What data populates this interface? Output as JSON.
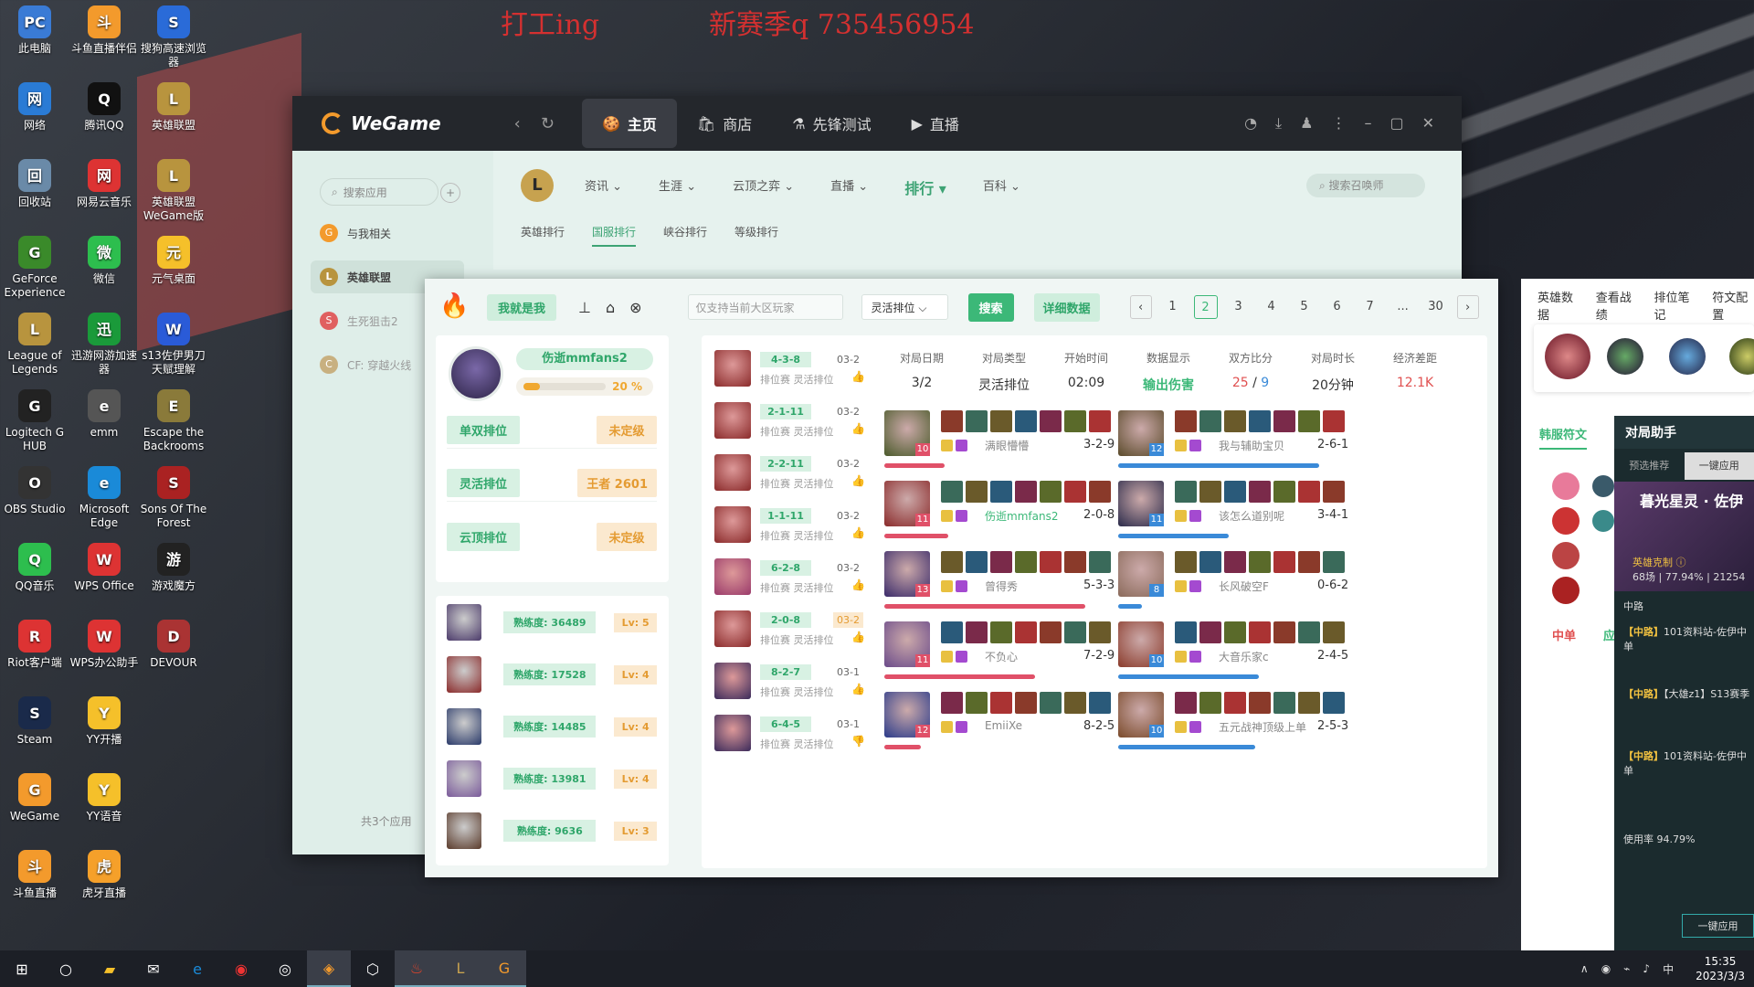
{
  "desktop_notes": [
    "打工ing",
    "新赛季q 735456954"
  ],
  "desktop_icons": [
    {
      "label": "此电脑",
      "color": "#3a7bd5",
      "g": "PC"
    },
    {
      "label": "斗鱼直播伴侣",
      "color": "#f39a2c",
      "g": "斗"
    },
    {
      "label": "搜狗高速浏览器",
      "color": "#2a6bd8",
      "g": "S"
    },
    {
      "label": "网络",
      "color": "#2a7bd5",
      "g": "网"
    },
    {
      "label": "腾讯QQ",
      "color": "#111",
      "g": "Q"
    },
    {
      "label": "英雄联盟",
      "color": "#b8943e",
      "g": "L"
    },
    {
      "label": "回收站",
      "color": "#6a8aa8",
      "g": "回"
    },
    {
      "label": "网易云音乐",
      "color": "#d33",
      "g": "网"
    },
    {
      "label": "英雄联盟WeGame版",
      "color": "#b8943e",
      "g": "L"
    },
    {
      "label": "GeForce Experience",
      "color": "#3a8a2a",
      "g": "G"
    },
    {
      "label": "微信",
      "color": "#2dbe4e",
      "g": "微"
    },
    {
      "label": "元气桌面",
      "color": "#f5c02a",
      "g": "元"
    },
    {
      "label": "League of Legends",
      "color": "#b8943e",
      "g": "L"
    },
    {
      "label": "迅游网游加速器",
      "color": "#1a9a3a",
      "g": "迅"
    },
    {
      "label": "s13佐伊男刀天赋理解",
      "color": "#2a5bd8",
      "g": "W"
    },
    {
      "label": "Logitech G HUB",
      "color": "#222",
      "g": "G"
    },
    {
      "label": "emm",
      "color": "#555",
      "g": "e"
    },
    {
      "label": "Escape the Backrooms",
      "color": "#8a7a3a",
      "g": "E"
    },
    {
      "label": "OBS Studio",
      "color": "#333",
      "g": "O"
    },
    {
      "label": "Microsoft Edge",
      "color": "#1a8ad8",
      "g": "e"
    },
    {
      "label": "Sons Of The Forest",
      "color": "#a22",
      "g": "S"
    },
    {
      "label": "QQ音乐",
      "color": "#2dbe4e",
      "g": "Q"
    },
    {
      "label": "WPS Office",
      "color": "#d33",
      "g": "W"
    },
    {
      "label": "游戏魔方",
      "color": "#222",
      "g": "游"
    },
    {
      "label": "Riot客户端",
      "color": "#d33",
      "g": "R"
    },
    {
      "label": "WPS办公助手",
      "color": "#d33",
      "g": "W"
    },
    {
      "label": "DEVOUR",
      "color": "#a33",
      "g": "D"
    },
    {
      "label": "Steam",
      "color": "#1a2a4a",
      "g": "S"
    },
    {
      "label": "YY开播",
      "color": "#f5c02a",
      "g": "Y"
    },
    {
      "label": "WeGame",
      "color": "#f39a2c",
      "g": "G"
    },
    {
      "label": "YY语音",
      "color": "#f5c02a",
      "g": "Y"
    },
    {
      "label": "斗鱼直播",
      "color": "#f39a2c",
      "g": "斗"
    },
    {
      "label": "虎牙直播",
      "color": "#f5a02a",
      "g": "虎"
    }
  ],
  "wegame": {
    "logo": "WeGame",
    "tabs": [
      {
        "label": "主页",
        "icon": "🍪"
      },
      {
        "label": "商店",
        "icon": "🛍"
      },
      {
        "label": "先锋测试",
        "icon": "⚗"
      },
      {
        "label": "直播",
        "icon": "▶"
      }
    ],
    "search_placeholder": "搜索应用",
    "sidebar": [
      "与我相关",
      "英雄联盟",
      "生死狙击2",
      "CF: 穿越火线"
    ],
    "sidebar_footer": "共3个应用",
    "lol_nav": [
      "资讯",
      "生涯",
      "云顶之弈",
      "直播",
      "排行",
      "百科"
    ],
    "lol_search": "搜索召唤师",
    "lol_sub": [
      "英雄排行",
      "国服排行",
      "峡谷排行",
      "等级排行"
    ]
  },
  "panel": {
    "toolbar": {
      "me_btn": "我就是我",
      "input_placeholder": "仅支持当前大区玩家",
      "select": "灵活排位 ⌵",
      "search_btn": "搜索",
      "detail_btn": "详细数据",
      "pages": [
        "1",
        "2",
        "3",
        "4",
        "5",
        "6",
        "7",
        "...",
        "30"
      ],
      "active_page": "2"
    },
    "profile": {
      "name": "伤逝mmfans2",
      "xp": "20 %",
      "xp_value": 0.2,
      "ranks": [
        {
          "k": "单双排位",
          "v": "未定级"
        },
        {
          "k": "灵活排位",
          "v": "王者 2601"
        },
        {
          "k": "云顶排位",
          "v": "未定级"
        }
      ]
    },
    "champions": [
      {
        "mastery": "熟练度: 36489",
        "lv": "Lv: 5",
        "color": "#4b3a6a"
      },
      {
        "mastery": "熟练度: 17528",
        "lv": "Lv: 4",
        "color": "#8a2a2a"
      },
      {
        "mastery": "熟练度: 14485",
        "lv": "Lv: 4",
        "color": "#2a3a6a"
      },
      {
        "mastery": "熟练度: 13981",
        "lv": "Lv: 4",
        "color": "#7a5a9a"
      },
      {
        "mastery": "熟练度: 9636",
        "lv": "Lv: 3",
        "color": "#5a3a2a"
      }
    ],
    "matches": [
      {
        "kda": "4-3-8",
        "date": "03-2",
        "mode": "排位赛 灵活排位",
        "win": true,
        "color": "#8a2a2a",
        "hl": false
      },
      {
        "kda": "2-1-11",
        "date": "03-2",
        "mode": "排位赛 灵活排位",
        "win": true,
        "color": "#8a2a2a",
        "hl": false
      },
      {
        "kda": "2-2-11",
        "date": "03-2",
        "mode": "排位赛 灵活排位",
        "win": true,
        "color": "#8a2a2a",
        "hl": false
      },
      {
        "kda": "1-1-11",
        "date": "03-2",
        "mode": "排位赛 灵活排位",
        "win": true,
        "color": "#8a2a2a",
        "hl": false
      },
      {
        "kda": "6-2-8",
        "date": "03-2",
        "mode": "排位赛 灵活排位",
        "win": true,
        "color": "#9a3a6a",
        "hl": false
      },
      {
        "kda": "2-0-8",
        "date": "03-2",
        "mode": "排位赛 灵活排位",
        "win": true,
        "color": "#8a2a2a",
        "hl": true
      },
      {
        "kda": "8-2-7",
        "date": "03-1",
        "mode": "排位赛 灵活排位",
        "win": true,
        "color": "#3a2a5a",
        "hl": false
      },
      {
        "kda": "6-4-5",
        "date": "03-1",
        "mode": "排位赛 灵活排位",
        "win": false,
        "color": "#3a2a5a",
        "hl": false
      }
    ],
    "detail_headers": [
      "对局日期",
      "对局类型",
      "开始时间",
      "数据显示",
      "双方比分",
      "对局时长",
      "经济差距"
    ],
    "detail_values": {
      "date": "3/2",
      "type": "灵活排位",
      "start": "02:09",
      "show": "输出伤害",
      "score_a": "25",
      "score_sep": " / ",
      "score_b": "9",
      "dur": "20分钟",
      "gold": "12.1K"
    },
    "team_red": [
      {
        "name": "满眼懵懵",
        "kda": "3-2-9",
        "lv": "10",
        "dmg": 0.3,
        "color": "#4a5a2a",
        "me": false
      },
      {
        "name": "伤逝mmfans2",
        "kda": "2-0-8",
        "lv": "11",
        "dmg": 0.32,
        "color": "#8a2a2a",
        "me": true
      },
      {
        "name": "曾得秀",
        "kda": "5-3-3",
        "lv": "13",
        "dmg": 1.0,
        "color": "#3a2a6a",
        "me": false
      },
      {
        "name": "不负心",
        "kda": "7-2-9",
        "lv": "11",
        "dmg": 0.75,
        "color": "#6a4a8a",
        "me": false
      },
      {
        "name": "EmiiXe",
        "kda": "8-2-5",
        "lv": "12",
        "dmg": 0.18,
        "color": "#2a3a8a",
        "me": false
      }
    ],
    "team_blue": [
      {
        "name": "我与辅助宝贝",
        "kda": "2-6-1",
        "lv": "12",
        "dmg": 1.0,
        "color": "#5a4a2a"
      },
      {
        "name": "该怎么道别呢",
        "kda": "3-4-1",
        "lv": "11",
        "dmg": 0.55,
        "color": "#2a2a4a"
      },
      {
        "name": "长风破空F",
        "kda": "0-6-2",
        "lv": "8",
        "dmg": 0.12,
        "color": "#8a6a5a"
      },
      {
        "name": "大音乐家c",
        "kda": "2-4-5",
        "lv": "10",
        "dmg": 0.7,
        "color": "#8a3a2a"
      },
      {
        "name": "五元战神顶级上单",
        "kda": "2-5-3",
        "lv": "10",
        "dmg": 0.68,
        "color": "#7a4a2a"
      }
    ]
  },
  "right_panel": {
    "tabs": [
      "英雄数据",
      "查看战绩",
      "排位笔记",
      "符文配置"
    ],
    "subtab": "韩服符文",
    "lane": "中单",
    "apply": "应用"
  },
  "helper": {
    "title": "对局助手",
    "tabs": [
      "预选推荐",
      "一键应用"
    ],
    "champ": "暮光星灵 · 佐伊",
    "counter": "英雄克制 ⓘ",
    "stats": "68场 | 77.94% | 21254",
    "lane": "中路",
    "sec1": "【中路】",
    "sec1_text": "101资料站-佐伊中单",
    "sec2": "【中路】",
    "sec2_text": "【大雄z1】S13赛季",
    "sec3": "【中路】",
    "sec3_text": "101资料站-佐伊中单",
    "usage": "使用率 94.79%",
    "apply_btn": "一键应用"
  },
  "taskbar": {
    "time": "15:35",
    "date": "2023/3/3",
    "ime": "中"
  }
}
